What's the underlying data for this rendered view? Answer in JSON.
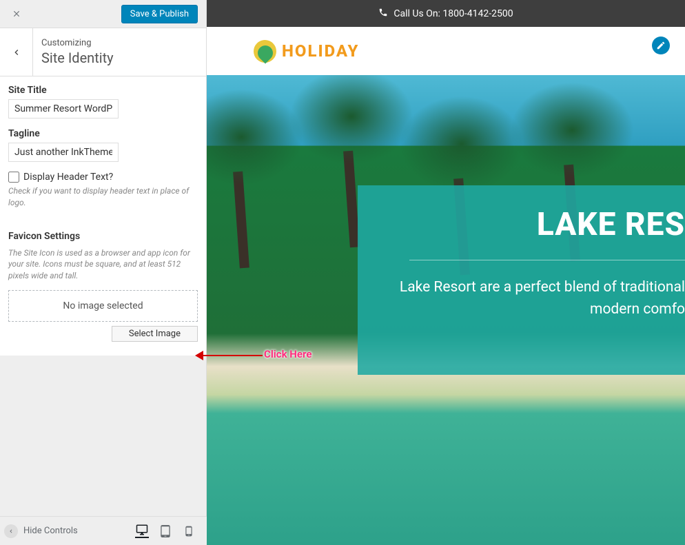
{
  "header": {
    "save_publish": "Save & Publish",
    "customizing_label": "Customizing",
    "section_title": "Site Identity"
  },
  "fields": {
    "site_title_label": "Site Title",
    "site_title_value": "Summer Resort WordPre",
    "tagline_label": "Tagline",
    "tagline_value": "Just another InkThemes",
    "display_header_label": "Display Header Text?",
    "display_header_help": "Check if you want to display header text in place of logo."
  },
  "favicon": {
    "heading": "Favicon Settings",
    "description": "The Site Icon is used as a browser and app icon for your site. Icons must be square, and at least 512 pixels wide and tall.",
    "no_image": "No image selected",
    "select_button": "Select Image"
  },
  "footer": {
    "hide_controls": "Hide Controls"
  },
  "preview": {
    "call_us": "Call Us On: 1800-4142-2500",
    "logo_text": "HOLIDAY",
    "hero_title": "LAKE RES",
    "hero_sub1": "Lake Resort are a perfect blend of traditional ",
    "hero_sub2": "modern comfo"
  },
  "annotation": {
    "click_here": "Click Here"
  }
}
